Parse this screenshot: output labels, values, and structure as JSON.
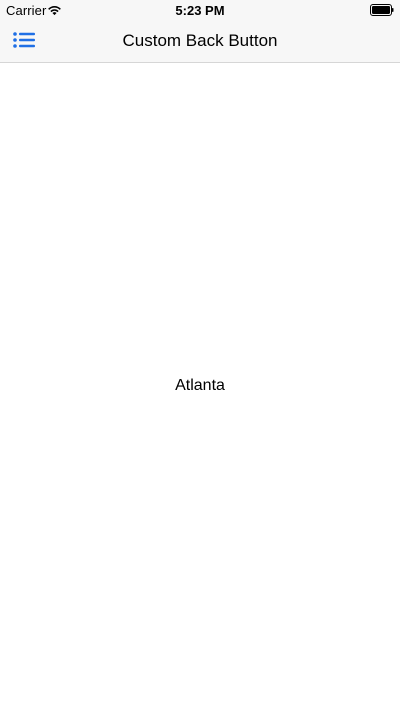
{
  "status_bar": {
    "carrier": "Carrier",
    "time": "5:23 PM",
    "icons": [
      "wifi-icon",
      "battery-icon"
    ]
  },
  "nav_bar": {
    "title": "Custom Back Button",
    "menu_icon": "list-icon",
    "accent_color": "#1f6fe5"
  },
  "content": {
    "label": "Atlanta"
  }
}
